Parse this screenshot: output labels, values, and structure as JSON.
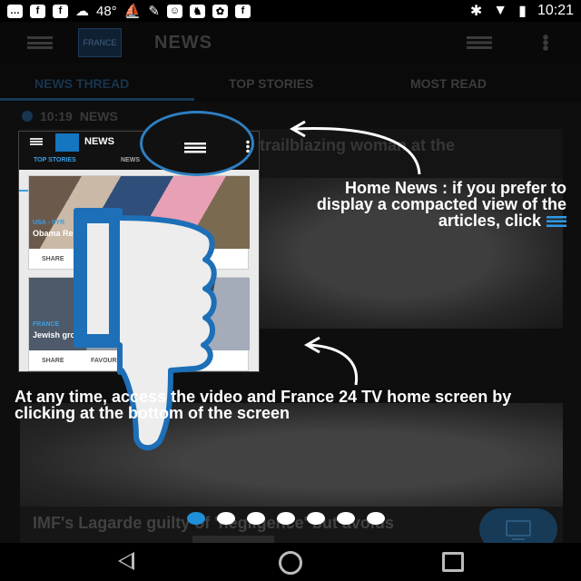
{
  "status_bar": {
    "temperature": "48°",
    "time": "10:21",
    "icons": [
      "messages-icon",
      "facebook-icon",
      "facebook-icon",
      "weather-icon",
      "paddle-icon",
      "wrench-icon",
      "mask-icon",
      "game-icon",
      "cat-icon",
      "facebook-icon",
      "bluetooth-icon",
      "wifi-icon",
      "battery-icon"
    ]
  },
  "app_bar": {
    "logo_text": "FRANCE 24",
    "title": "NEWS"
  },
  "tabs": [
    {
      "label": "NEWS THREAD",
      "active": true
    },
    {
      "label": "TOP STORIES",
      "active": false
    },
    {
      "label": "MOST READ",
      "active": false
    }
  ],
  "thread": {
    "time": "10:19",
    "section": "NEWS",
    "card1_headline": "trailblazing woman at the",
    "card2_headline": "IMF's Lagarde guilty of 'negligence' but avoids"
  },
  "mini_preview": {
    "title": "NEWS",
    "tab1": "TOP STORIES",
    "tab2": "NEWS",
    "card1_tag": "USA - SYR",
    "card1_headline": "Obama Republic",
    "card2_tag": "FRANCE",
    "card2_headline": "Jewish group s",
    "share_label": "SHARE",
    "favourite_label": "FAVOURI"
  },
  "tips": {
    "home_news": "Home News : if you prefer to display a compacted view of the articles, click",
    "video": "At any time, access the video and France 24 TV home screen by clicking at the bottom of the screen"
  },
  "pager": {
    "count": 7,
    "active_index": 0
  },
  "colors": {
    "accent": "#1f8fd9",
    "highlight_ring": "#2e7fc1",
    "hand_fill": "#ededed",
    "hand_outline": "#1d6fb8"
  }
}
